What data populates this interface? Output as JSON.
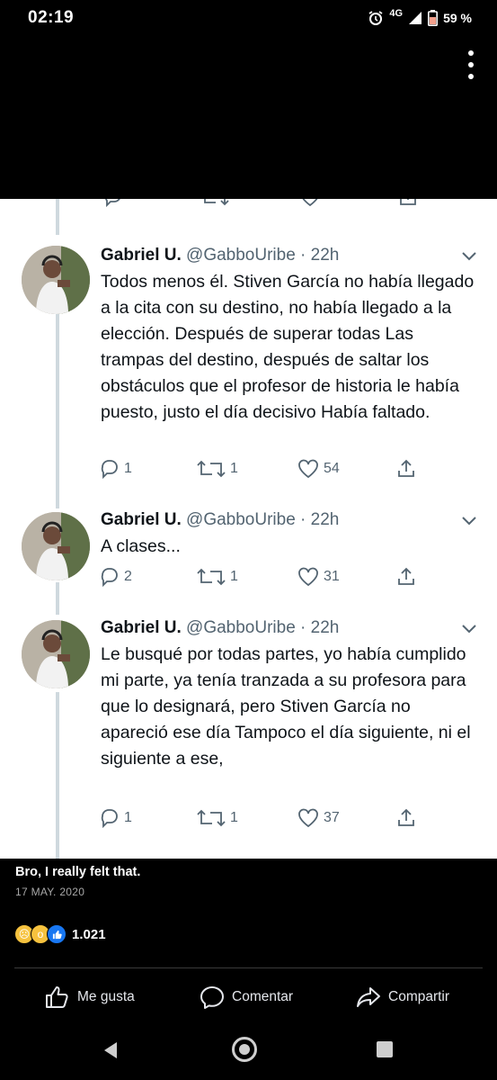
{
  "status_bar": {
    "time": "02:19",
    "network": "4G",
    "battery": "59 %"
  },
  "tweets": [
    {
      "name": "Gabriel U.",
      "handle": "@GabboUribe",
      "time": "22h",
      "text": "Todos menos él. Stiven García no había llegado a la cita con su destino, no había llegado a la elección. Después de superar todas Las trampas del destino, después de saltar los obstáculos que el profesor de historia le había puesto, justo el día decisivo Había faltado.",
      "replies": "1",
      "retweets": "1",
      "likes": "54"
    },
    {
      "name": "Gabriel U.",
      "handle": "@GabboUribe",
      "time": "22h",
      "text": "A clases...",
      "replies": "2",
      "retweets": "1",
      "likes": "31"
    },
    {
      "name": "Gabriel U.",
      "handle": "@GabboUribe",
      "time": "22h",
      "text": "Le busqué por todas partes, yo había cumplido mi parte, ya tenía tranzada a su profesora para que lo designará, pero Stiven García no apareció ese día Tampoco el día siguiente, ni el siguiente a ese,",
      "replies": "1",
      "retweets": "1",
      "likes": "37"
    }
  ],
  "post": {
    "caption": "Bro, I really felt that.",
    "date": "17 MAY. 2020",
    "reaction_count": "1.021",
    "reaction_icons": [
      "sad-reaction-icon",
      "wow-reaction-icon",
      "like-reaction-icon"
    ]
  },
  "actions": {
    "like": "Me gusta",
    "comment": "Comentar",
    "share": "Compartir"
  },
  "colors": {
    "background": "#000000",
    "tweet_card": "#ffffff",
    "twitter_gray": "#536471",
    "facebook_blue": "#1877f2"
  }
}
